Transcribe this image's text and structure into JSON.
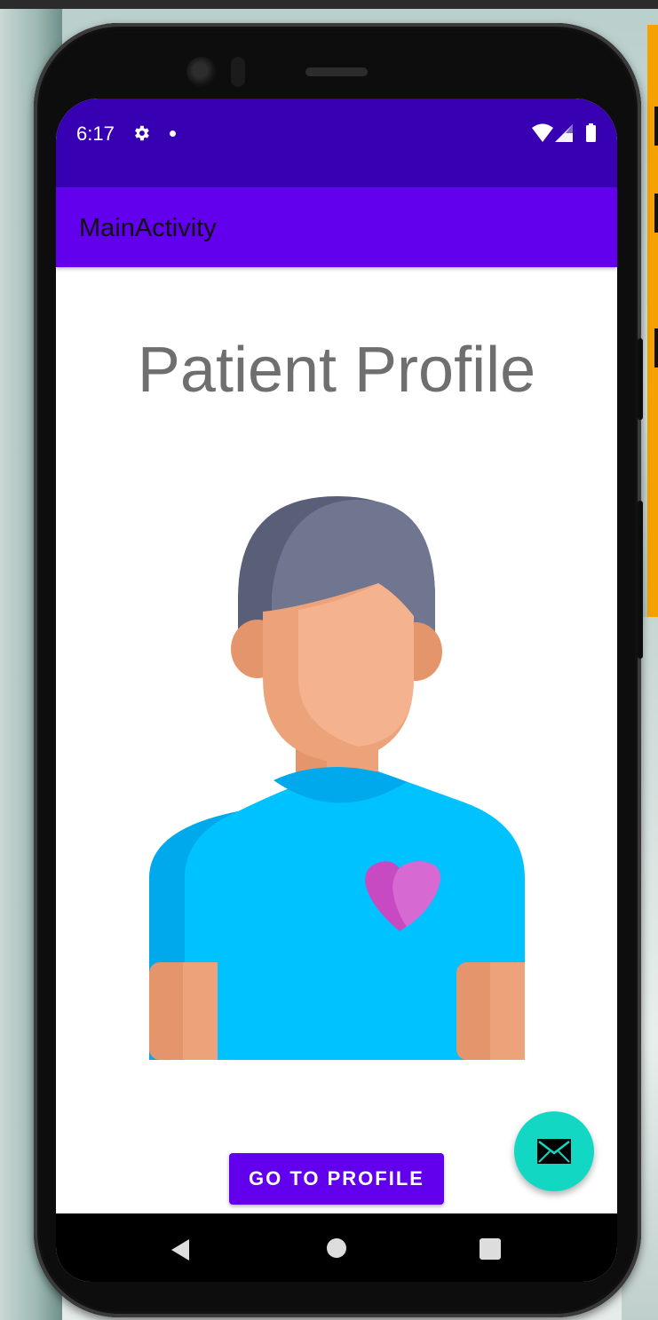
{
  "status_bar": {
    "time": "6:17",
    "icons": [
      "gear-icon",
      "notification-dot-icon",
      "wifi-icon",
      "signal-icon",
      "battery-icon"
    ]
  },
  "app_bar": {
    "title": "MainActivity"
  },
  "main": {
    "heading": "Patient Profile",
    "avatar_icon": "patient-avatar-icon",
    "button_label": "GO TO PROFILE"
  },
  "fab": {
    "icon": "mail-icon"
  },
  "nav_bar": {
    "icons": [
      "back-icon",
      "home-icon",
      "recents-icon"
    ]
  },
  "colors": {
    "status_bar": "#3700b3",
    "app_bar": "#6200ee",
    "button": "#6200ee",
    "fab": "#12d7c3",
    "heading_text": "#6f6f6f",
    "shirt": "#00c2ff",
    "heart": "#c74ac2"
  }
}
